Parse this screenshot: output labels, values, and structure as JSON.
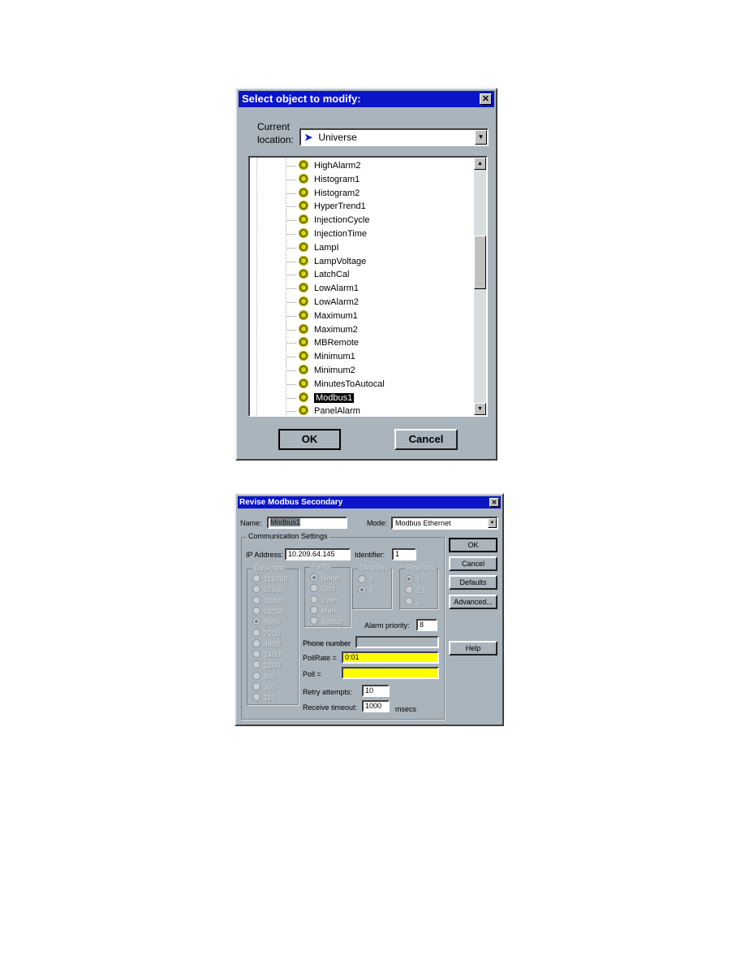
{
  "select_dialog": {
    "title": "Select object to modify:",
    "location_label_1": "Current",
    "location_label_2": "location:",
    "location_value": "Universe",
    "items": [
      "HighAlarm2",
      "Histogram1",
      "Histogram2",
      "HyperTrend1",
      "InjectionCycle",
      "InjectionTime",
      "LampI",
      "LampVoltage",
      "LatchCal",
      "LowAlarm1",
      "LowAlarm2",
      "Maximum1",
      "Maximum2",
      "MBRemote",
      "Minimum1",
      "Minimum2",
      "MinutesToAutocal",
      "Modbus1",
      "PanelAlarm"
    ],
    "selected_item": "Modbus1",
    "ok": "OK",
    "cancel": "Cancel"
  },
  "modbus_dialog": {
    "title": "Revise Modbus Secondary",
    "name_label": "Name:",
    "name_value": "Modbus1",
    "mode_label": "Mode:",
    "mode_value": "Modbus Ethernet",
    "comm_group": "Communication Settings",
    "ip_label": "IP Address:",
    "ip_value": "10.209.64.145",
    "identifier_label": "Identifier:",
    "identifier_value": "1",
    "data_rate_label": "Data rate",
    "data_rates": [
      "115200",
      "57600",
      "38400",
      "19200",
      "9600",
      "7200",
      "4800",
      "2400",
      "1200",
      "600",
      "300",
      "110"
    ],
    "data_rate_selected": "9600",
    "parity_label": "Parity",
    "parity": [
      "None",
      "Odd",
      "Even",
      "Mark",
      "Space"
    ],
    "parity_selected": "None",
    "data_bits_label": "Data bits",
    "data_bits": [
      "7",
      "8"
    ],
    "data_bits_selected": "8",
    "stop_bits_label": "Stop bits",
    "stop_bits": [
      "1",
      "1.5",
      "2"
    ],
    "stop_bits_selected": "1",
    "alarm_priority_label": "Alarm priority:",
    "alarm_priority_value": "8",
    "phone_label": "Phone number",
    "pollrate_label": "PollRate =",
    "pollrate_value": "0:01",
    "poll_label": "Poll =",
    "poll_value": "",
    "retry_label": "Retry attempts:",
    "retry_value": "10",
    "timeout_label": "Receive timeout:",
    "timeout_value": "1000",
    "timeout_unit": "msecs",
    "buttons": {
      "ok": "OK",
      "cancel": "Cancel",
      "defaults": "Defaults",
      "advanced": "Advanced...",
      "help": "Help"
    },
    "highlight_color": "#ffff00"
  }
}
